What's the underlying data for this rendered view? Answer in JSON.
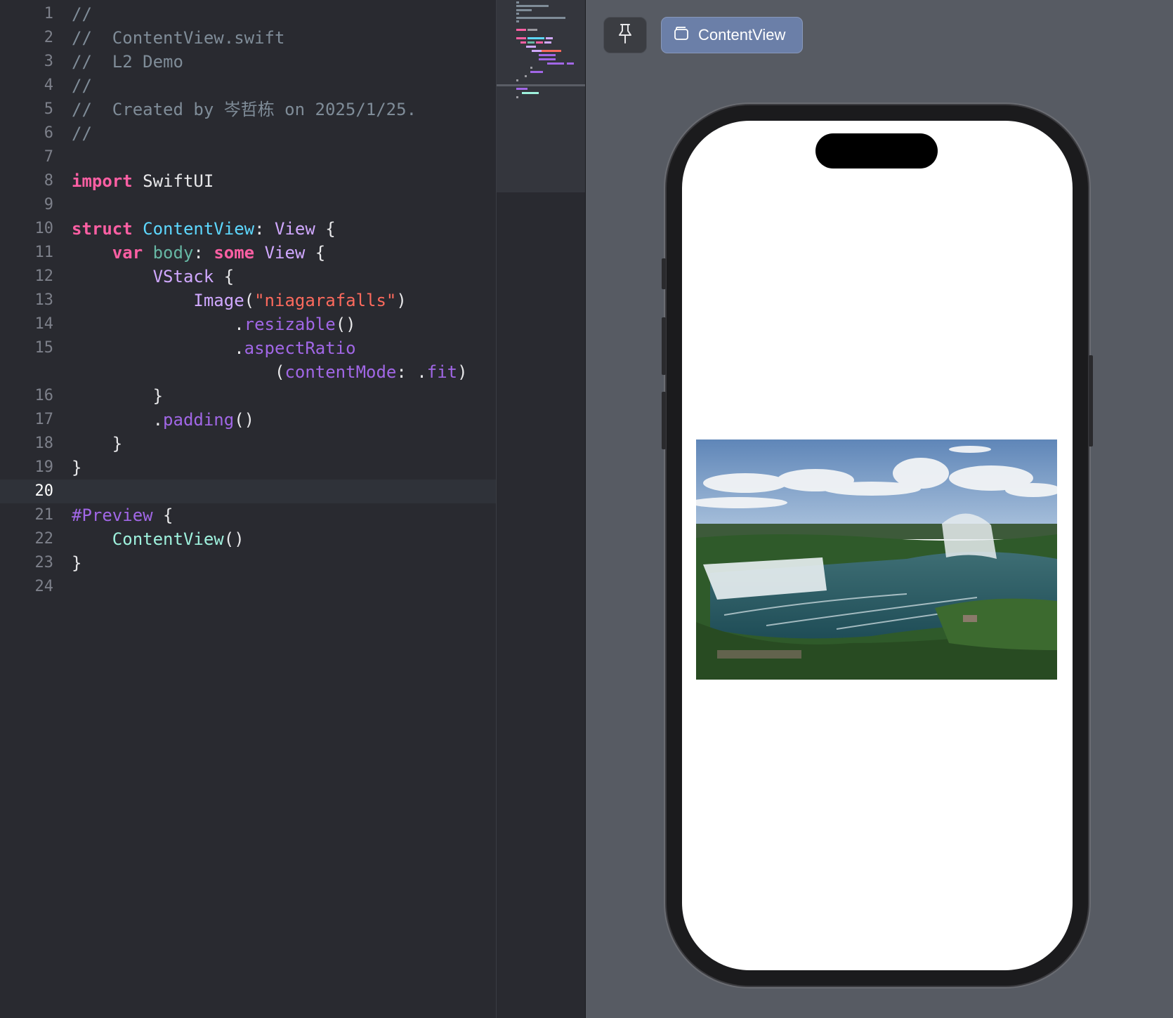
{
  "editor": {
    "current_line": 20,
    "lines": [
      {
        "n": "1",
        "tokens": [
          {
            "t": "//",
            "c": "comment"
          }
        ]
      },
      {
        "n": "2",
        "tokens": [
          {
            "t": "//  ContentView.swift",
            "c": "comment"
          }
        ]
      },
      {
        "n": "3",
        "tokens": [
          {
            "t": "//  L2 Demo",
            "c": "comment"
          }
        ]
      },
      {
        "n": "4",
        "tokens": [
          {
            "t": "//",
            "c": "comment"
          }
        ]
      },
      {
        "n": "5",
        "tokens": [
          {
            "t": "//  Created by 岑哲栋 on 2025/1/25.",
            "c": "comment"
          }
        ]
      },
      {
        "n": "6",
        "tokens": [
          {
            "t": "//",
            "c": "comment"
          }
        ]
      },
      {
        "n": "7",
        "tokens": []
      },
      {
        "n": "8",
        "tokens": [
          {
            "t": "import",
            "c": "keyword"
          },
          {
            "t": " SwiftUI",
            "c": "plain"
          }
        ]
      },
      {
        "n": "9",
        "tokens": []
      },
      {
        "n": "10",
        "tokens": [
          {
            "t": "struct",
            "c": "keyword"
          },
          {
            "t": " ",
            "c": "plain"
          },
          {
            "t": "ContentView",
            "c": "typedecl"
          },
          {
            "t": ": ",
            "c": "plain"
          },
          {
            "t": "View",
            "c": "type"
          },
          {
            "t": " {",
            "c": "plain"
          }
        ]
      },
      {
        "n": "11",
        "tokens": [
          {
            "t": "    ",
            "c": "plain"
          },
          {
            "t": "var",
            "c": "keyword"
          },
          {
            "t": " ",
            "c": "plain"
          },
          {
            "t": "body",
            "c": "prop"
          },
          {
            "t": ": ",
            "c": "plain"
          },
          {
            "t": "some",
            "c": "keyword"
          },
          {
            "t": " ",
            "c": "plain"
          },
          {
            "t": "View",
            "c": "type"
          },
          {
            "t": " {",
            "c": "plain"
          }
        ]
      },
      {
        "n": "12",
        "tokens": [
          {
            "t": "        ",
            "c": "plain"
          },
          {
            "t": "VStack",
            "c": "type"
          },
          {
            "t": " {",
            "c": "plain"
          }
        ]
      },
      {
        "n": "13",
        "tokens": [
          {
            "t": "            ",
            "c": "plain"
          },
          {
            "t": "Image",
            "c": "type"
          },
          {
            "t": "(",
            "c": "plain"
          },
          {
            "t": "\"niagarafalls\"",
            "c": "string"
          },
          {
            "t": ")",
            "c": "plain"
          }
        ]
      },
      {
        "n": "14",
        "tokens": [
          {
            "t": "                .",
            "c": "plain"
          },
          {
            "t": "resizable",
            "c": "method"
          },
          {
            "t": "()",
            "c": "plain"
          }
        ]
      },
      {
        "n": "15",
        "tokens": [
          {
            "t": "                .",
            "c": "plain"
          },
          {
            "t": "aspectRatio",
            "c": "method"
          }
        ]
      },
      {
        "n": "",
        "tokens": [
          {
            "t": "                    (",
            "c": "plain"
          },
          {
            "t": "contentMode",
            "c": "method"
          },
          {
            "t": ": .",
            "c": "plain"
          },
          {
            "t": "fit",
            "c": "method"
          },
          {
            "t": ")",
            "c": "plain"
          }
        ]
      },
      {
        "n": "16",
        "tokens": [
          {
            "t": "        }",
            "c": "plain"
          }
        ]
      },
      {
        "n": "17",
        "tokens": [
          {
            "t": "        .",
            "c": "plain"
          },
          {
            "t": "padding",
            "c": "method"
          },
          {
            "t": "()",
            "c": "plain"
          }
        ]
      },
      {
        "n": "18",
        "tokens": [
          {
            "t": "    }",
            "c": "plain"
          }
        ]
      },
      {
        "n": "19",
        "tokens": [
          {
            "t": "}",
            "c": "plain"
          }
        ]
      },
      {
        "n": "20",
        "tokens": []
      },
      {
        "n": "21",
        "tokens": [
          {
            "t": "#Preview",
            "c": "method"
          },
          {
            "t": " {",
            "c": "plain"
          }
        ]
      },
      {
        "n": "22",
        "tokens": [
          {
            "t": "    ",
            "c": "plain"
          },
          {
            "t": "ContentView",
            "c": "func"
          },
          {
            "t": "()",
            "c": "plain"
          }
        ]
      },
      {
        "n": "23",
        "tokens": [
          {
            "t": "}",
            "c": "plain"
          }
        ]
      },
      {
        "n": "24",
        "tokens": []
      }
    ]
  },
  "preview": {
    "pin_icon": "pin-icon",
    "view_icon": "stack-icon",
    "view_label": "ContentView",
    "image_icon": "niagara-falls-photo"
  },
  "colors": {
    "editor_bg": "#292a30",
    "canvas_bg": "#575b63",
    "keyword": "#fc5fa3",
    "string": "#fc6a5d",
    "comment": "#7f8c98",
    "chip_bg": "#6b7fa8"
  }
}
